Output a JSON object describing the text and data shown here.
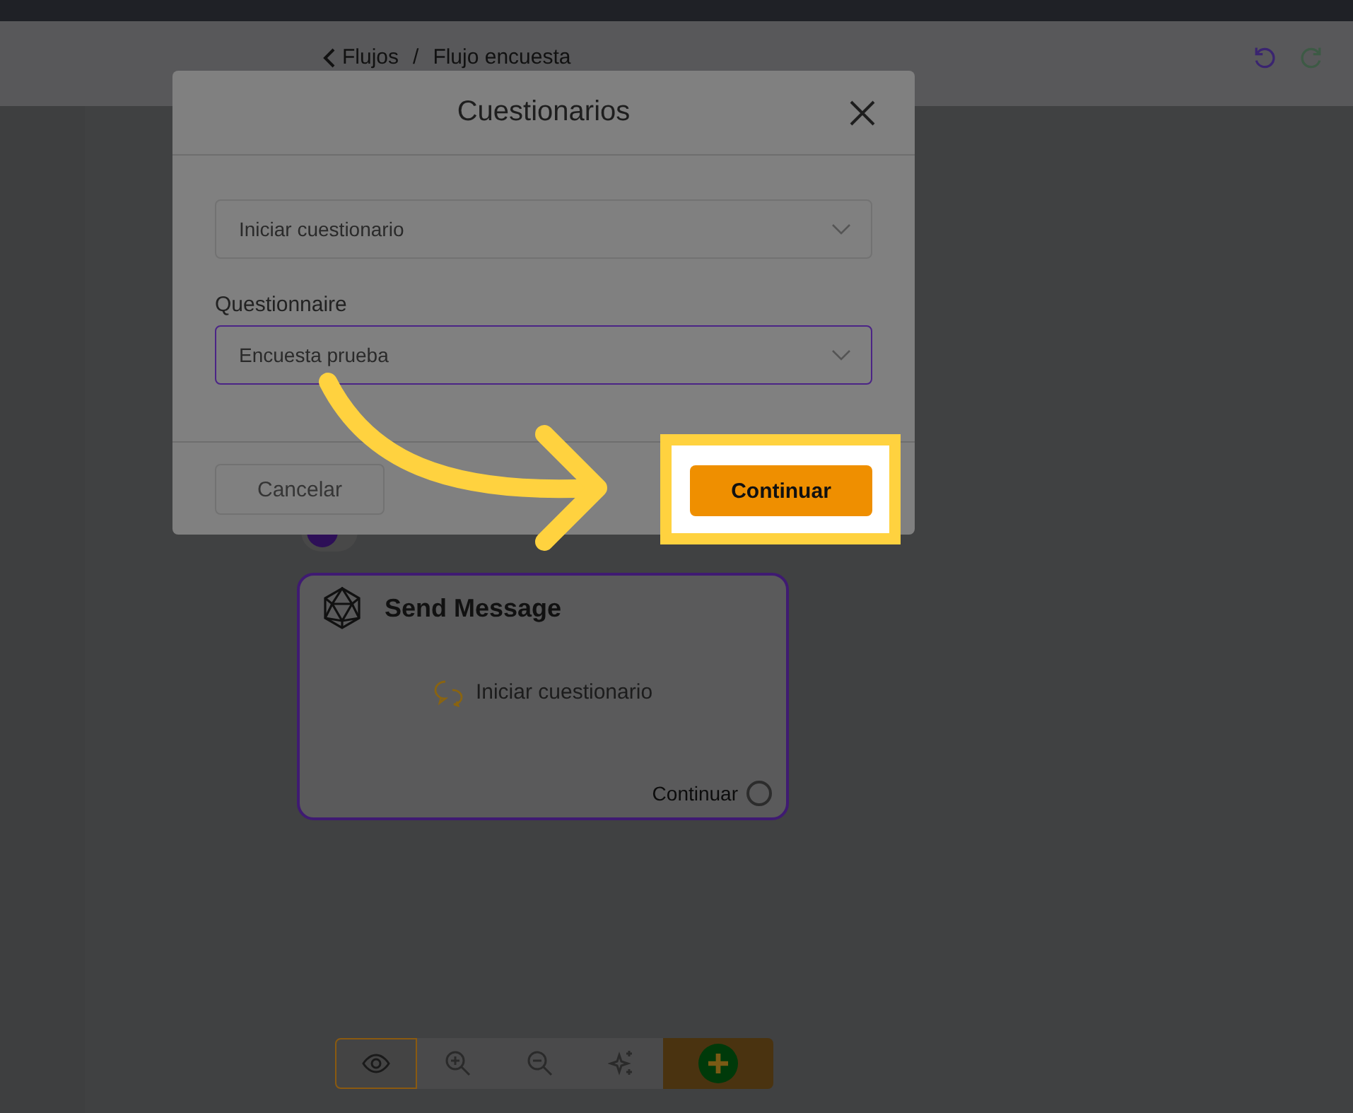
{
  "breadcrumb": [
    {
      "label": "Flujos",
      "kind": "back"
    },
    {
      "label": "/",
      "kind": "separator"
    },
    {
      "label": "Flujo encuesta",
      "kind": "current"
    }
  ],
  "start_badge": {
    "kind": "start"
  },
  "node": {
    "title": "Send Message",
    "action": "Iniciar cuestionario",
    "output": "Continuar"
  },
  "toolbar": [
    {
      "kind": "preview",
      "selected": true
    },
    {
      "kind": "zoom-in",
      "selected": false
    },
    {
      "kind": "zoom-out",
      "selected": false
    },
    {
      "kind": "magic",
      "selected": false
    },
    {
      "kind": "add",
      "selected": false
    }
  ],
  "modal": {
    "title": "Cuestionarios",
    "fields": [
      {
        "value": "Iniciar cuestionario",
        "focused": false
      },
      {
        "label": "Questionnaire",
        "value": "Encuesta prueba",
        "focused": true
      }
    ],
    "buttons": [
      {
        "label": "Cancelar",
        "kind": "secondary",
        "highlighted": false
      },
      {
        "label": "Continuar",
        "kind": "primary",
        "highlighted": true
      }
    ]
  }
}
